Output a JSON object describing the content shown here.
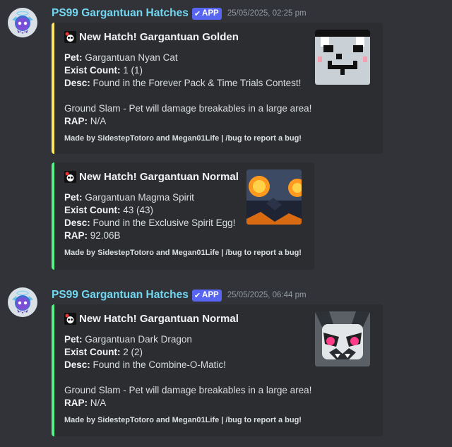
{
  "messages": [
    {
      "author": "PS99 Gargantuan Hatches",
      "badge": "APP",
      "timestamp": "25/05/2025, 02:25 pm",
      "embeds": [
        {
          "accent": "#fee75c",
          "title": "New Hatch! Gargantuan Golden",
          "pet_label": "Pet:",
          "pet": "Gargantuan Nyan Cat",
          "exist_label": "Exist Count:",
          "exist": "1 (1)",
          "desc_label": "Desc:",
          "desc": "Found in the Forever Pack & Time Trials Contest!",
          "ability": "Ground Slam - Pet will damage breakables in a large area!",
          "rap_label": "RAP:",
          "rap": "N/A",
          "footer": "Made by SidestepTotoro and Megan01Life | /bug to report a bug!",
          "thumbnail": "nyan-cat-pet"
        },
        {
          "accent": "#57f287",
          "title": "New Hatch! Gargantuan Normal",
          "pet_label": "Pet:",
          "pet": "Gargantuan Magma Spirit",
          "exist_label": "Exist Count:",
          "exist": "43 (43)",
          "desc_label": "Desc:",
          "desc": "Found in the Exclusive Spirit Egg!",
          "rap_label": "RAP:",
          "rap": "92.06B",
          "footer": "Made by SidestepTotoro and Megan01Life | /bug to report a bug!",
          "thumbnail": "magma-spirit-pet"
        }
      ]
    },
    {
      "author": "PS99 Gargantuan Hatches",
      "badge": "APP",
      "timestamp": "25/05/2025, 06:44 pm",
      "embeds": [
        {
          "accent": "#57f287",
          "title": "New Hatch! Gargantuan Normal",
          "pet_label": "Pet:",
          "pet": "Gargantuan Dark Dragon",
          "exist_label": "Exist Count:",
          "exist": "2 (2)",
          "desc_label": "Desc:",
          "desc": "Found in the Combine-O-Matic!",
          "ability": "Ground Slam - Pet will damage breakables in a large area!",
          "rap_label": "RAP:",
          "rap": "N/A",
          "footer": "Made by SidestepTotoro and Megan01Life | /bug to report a bug!",
          "thumbnail": "dark-dragon-pet"
        }
      ]
    }
  ]
}
